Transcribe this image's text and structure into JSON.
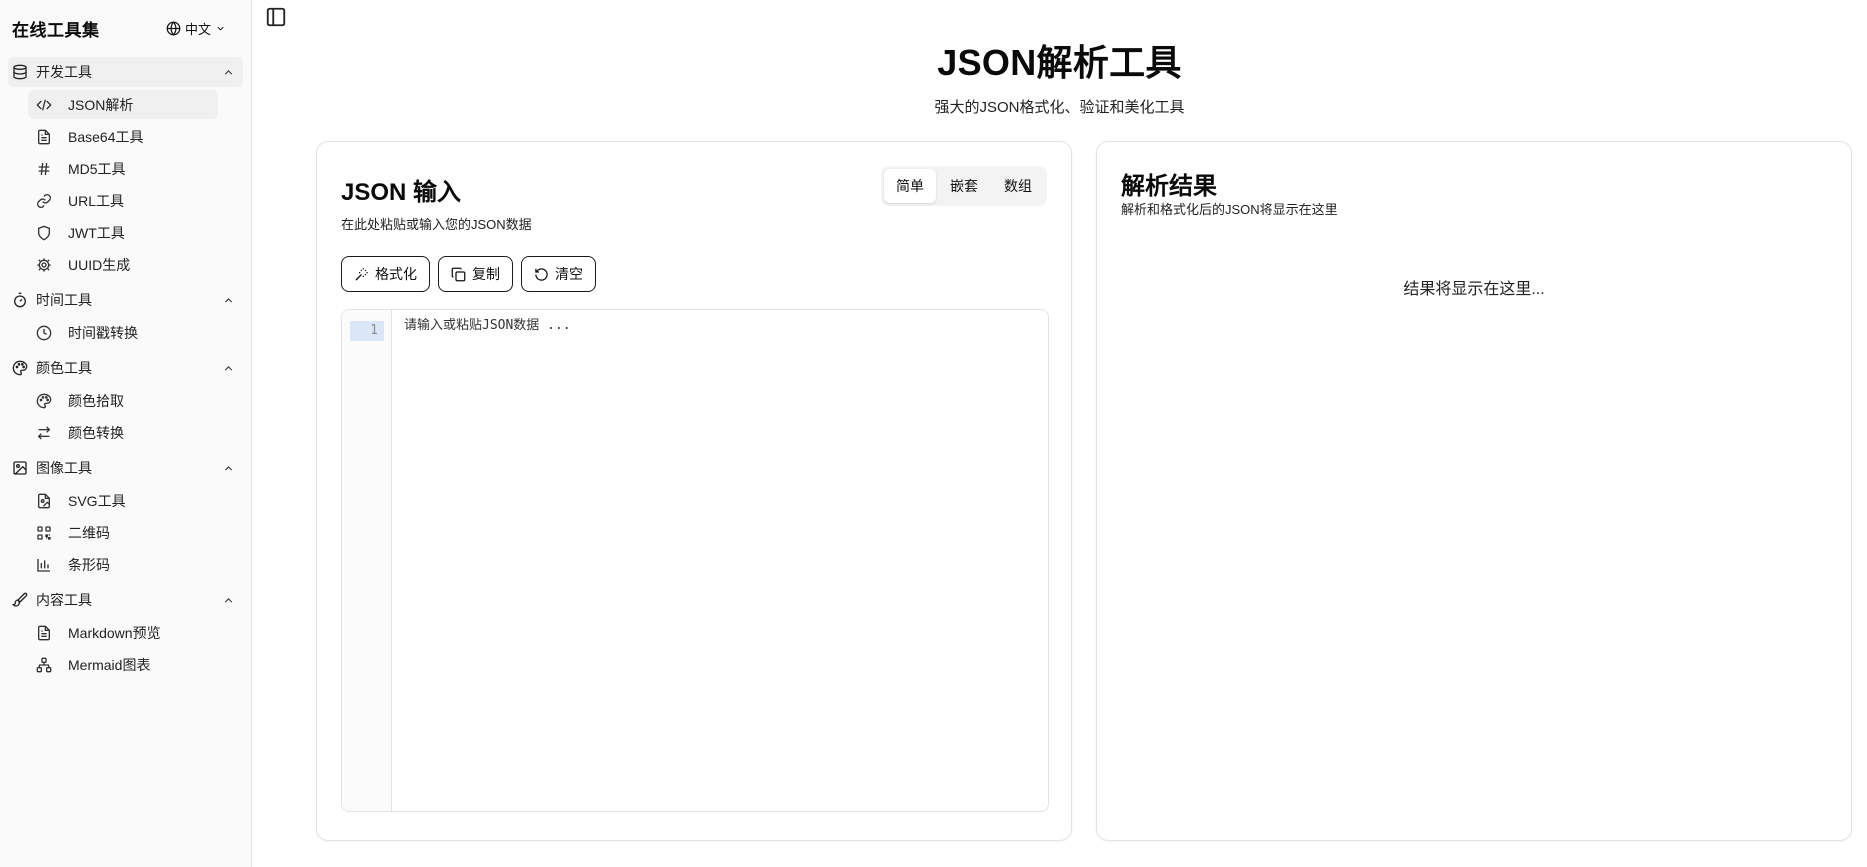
{
  "app": {
    "title": "在线工具集",
    "language": "中文"
  },
  "sidebar": {
    "groups": [
      {
        "label": "开发工具",
        "items": [
          {
            "label": "JSON解析"
          },
          {
            "label": "Base64工具"
          },
          {
            "label": "MD5工具"
          },
          {
            "label": "URL工具"
          },
          {
            "label": "JWT工具"
          },
          {
            "label": "UUID生成"
          }
        ]
      },
      {
        "label": "时间工具",
        "items": [
          {
            "label": "时间戳转换"
          }
        ]
      },
      {
        "label": "颜色工具",
        "items": [
          {
            "label": "颜色拾取"
          },
          {
            "label": "颜色转换"
          }
        ]
      },
      {
        "label": "图像工具",
        "items": [
          {
            "label": "SVG工具"
          },
          {
            "label": "二维码"
          },
          {
            "label": "条形码"
          }
        ]
      },
      {
        "label": "内容工具",
        "items": [
          {
            "label": "Markdown预览"
          },
          {
            "label": "Mermaid图表"
          }
        ]
      }
    ]
  },
  "page": {
    "title": "JSON解析工具",
    "subtitle": "强大的JSON格式化、验证和美化工具"
  },
  "input_card": {
    "title": "JSON 输入",
    "subtitle": "在此处粘贴或输入您的JSON数据",
    "examples": [
      "简单",
      "嵌套",
      "数组"
    ],
    "buttons": {
      "format": "格式化",
      "copy": "复制",
      "clear": "清空"
    },
    "editor": {
      "line_number": "1",
      "placeholder": "请输入或粘贴JSON数据 ...",
      "value": ""
    }
  },
  "output_card": {
    "title": "解析结果",
    "subtitle": "解析和格式化后的JSON将显示在这里",
    "placeholder": "结果将显示在这里..."
  }
}
